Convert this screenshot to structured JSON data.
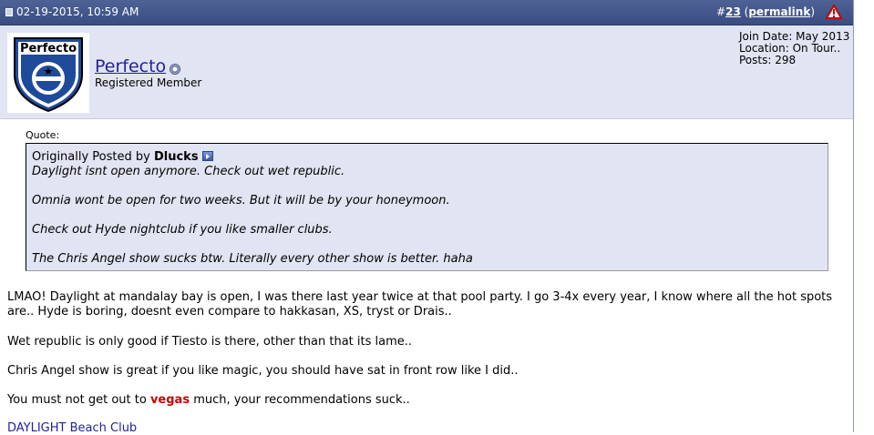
{
  "post": {
    "date": "02-19-2015, 10:59 AM",
    "number_prefix": "#",
    "number": "23",
    "permalink_label": "permalink",
    "paren_open": " (",
    "paren_close": ")"
  },
  "user": {
    "name": "Perfecto",
    "title": "Registered Member",
    "avatar_text": "Perfecto",
    "join_date": "Join Date: May 2013",
    "location": "Location: On Tour..",
    "posts": "Posts: 298"
  },
  "quote": {
    "label": "Quote:",
    "originally_posted_by": "Originally Posted by ",
    "author": "Dlucks",
    "lines": [
      "Daylight isnt open anymore. Check out wet republic.",
      "Omnia wont be open for two weeks. But it will be by your honeymoon.",
      "Check out Hyde nightclub if you like smaller clubs.",
      "The Chris Angel show sucks btw. Literally every other show is better. haha"
    ]
  },
  "message": {
    "p1": "LMAO! Daylight at mandalay bay is open, I was there last year twice at that pool party. I go 3-4x every year, I know where all the hot spots are.. Hyde is boring, doesnt even compare to hakkasan, XS, tryst or Drais..",
    "p2": "Wet republic is only good if Tiesto is there, other than that its lame..",
    "p3": "Chris Angel show is great if you like magic, you should have sat in front row like I did..",
    "p4_before": "You must not get out to ",
    "p4_highlight": "vegas",
    "p4_after": " much, your recommendations suck..",
    "signature_link": "DAYLIGHT Beach Club"
  },
  "colors": {
    "header_bg": "#3f5289",
    "userinfo_bg": "#e1e4f2",
    "link": "#22229c",
    "highlight": "#cc0000"
  },
  "icons": {
    "post_icon": "document-icon",
    "report_icon": "warning-triangle-icon",
    "online_icon": "offline-status-icon",
    "view_post_icon": "view-post-arrow-icon"
  }
}
